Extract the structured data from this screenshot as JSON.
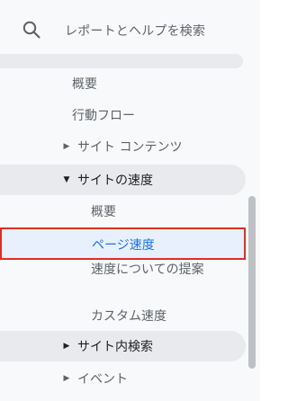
{
  "search": {
    "placeholder": "レポートとヘルプを検索"
  },
  "nav": {
    "overview": "概要",
    "behavior_flow": "行動フロー",
    "site_content": "サイト コンテンツ",
    "site_speed": "サイトの速度",
    "speed_overview": "概要",
    "page_timings": "ページ速度",
    "speed_suggestions": "速度についての提案",
    "custom_speed": "カスタム速度",
    "site_search": "サイト内検索",
    "events": "イベント"
  },
  "colors": {
    "selected_text": "#1a73e8",
    "selected_bg": "#e8f0fe",
    "highlight_border": "#d93025",
    "group_bg": "#e8eaed"
  }
}
